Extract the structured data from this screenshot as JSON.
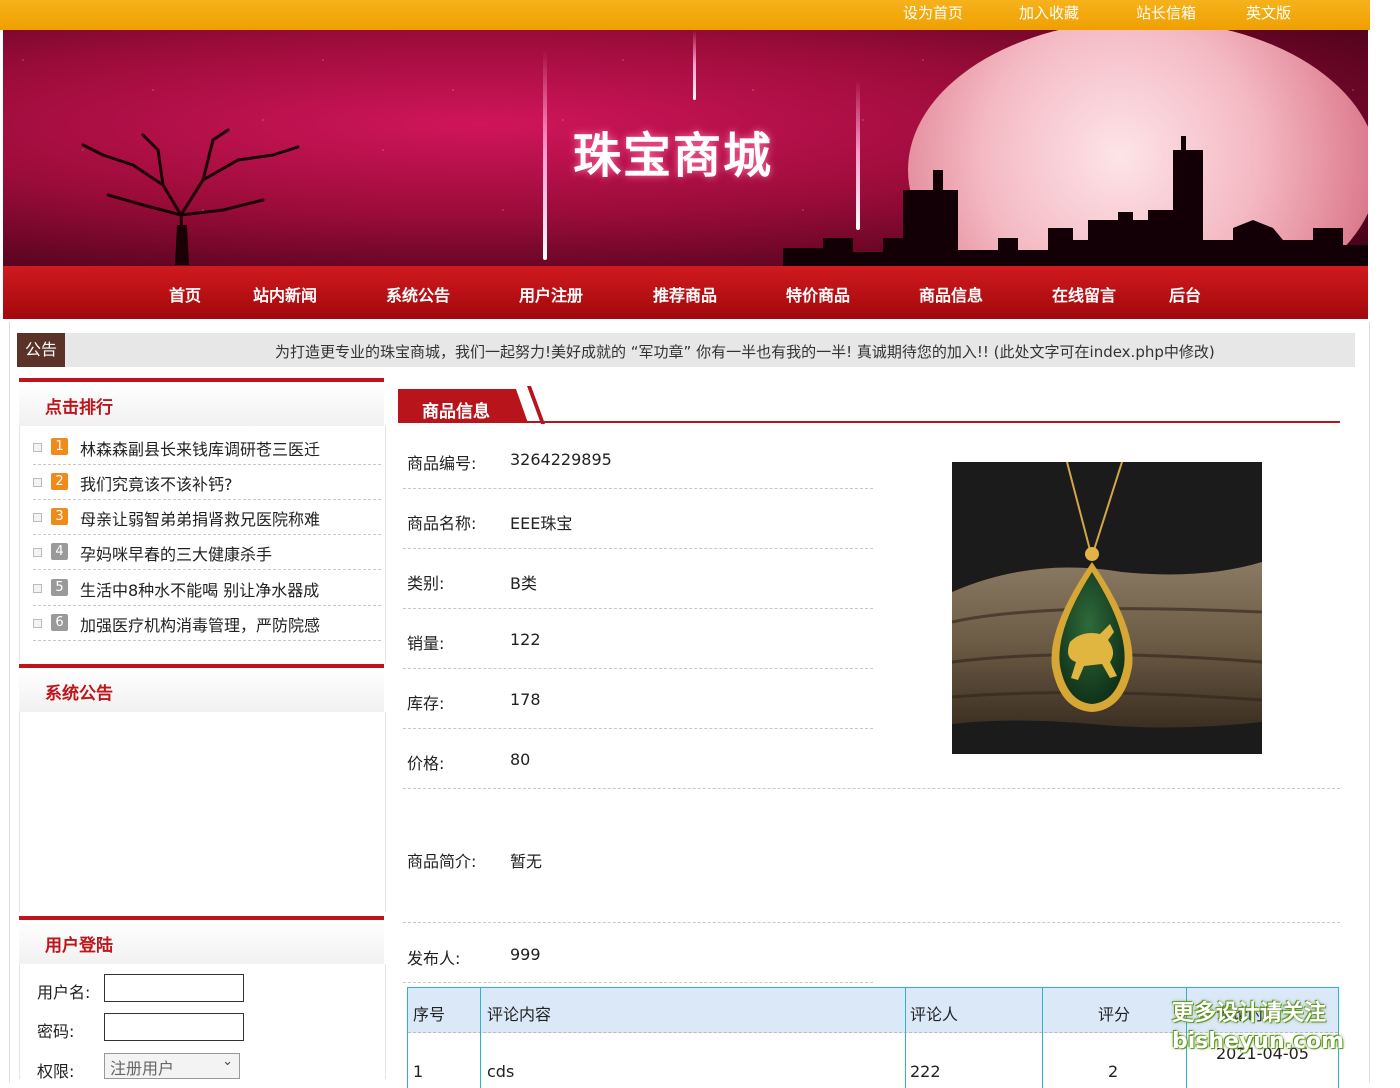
{
  "colors": {
    "top_bar": "#f6b21c",
    "nav_red": "#c0141b",
    "accent_red": "#b8141c",
    "notice_tag": "#5b3227",
    "table_border": "#29b4c8"
  },
  "top_links": [
    "设为首页",
    "加入收藏",
    "站长信箱",
    "英文版"
  ],
  "site_title": "珠宝商城",
  "nav": [
    "首页",
    "站内新闻",
    "系统公告",
    "用户注册",
    "推荐商品",
    "特价商品",
    "商品信息",
    "在线留言",
    "后台"
  ],
  "notice": {
    "tag": "公告",
    "text": "为打造更专业的珠宝商城，我们一起努力!美好成就的 “军功章” 你有一半也有我的一半! 真诚期待您的加入!! (此处文字可在index.php中修改)"
  },
  "ranking": {
    "title": "点击排行",
    "items": [
      {
        "num": "1",
        "label": "林森森副县长来钱库调研苍三医迁"
      },
      {
        "num": "2",
        "label": "我们究竟该不该补钙?"
      },
      {
        "num": "3",
        "label": "母亲让弱智弟弟捐肾救兄医院称难"
      },
      {
        "num": "4",
        "label": "孕妈咪早春的三大健康杀手"
      },
      {
        "num": "5",
        "label": "生活中8种水不能喝 别让净水器成"
      },
      {
        "num": "6",
        "label": "加强医疗机构消毒管理，严防院感"
      }
    ]
  },
  "announcements": {
    "title": "系统公告"
  },
  "login": {
    "title": "用户登陆",
    "username_label": "用户名:",
    "password_label": "密码:",
    "role_label": "权限:",
    "role_value": "注册用户"
  },
  "product": {
    "section_title": "商品信息",
    "fields": {
      "id": {
        "label": "商品编号:",
        "value": "3264229895"
      },
      "name": {
        "label": "商品名称:",
        "value": "EEE珠宝"
      },
      "category": {
        "label": "类别:",
        "value": "B类"
      },
      "sales": {
        "label": "销量:",
        "value": "122"
      },
      "stock": {
        "label": "库存:",
        "value": "178"
      },
      "price": {
        "label": "价格:",
        "value": "80"
      },
      "intro": {
        "label": "商品简介:",
        "value": "暂无"
      },
      "publisher": {
        "label": "发布人:",
        "value": "999"
      }
    }
  },
  "comments": {
    "headers": [
      "序号",
      "评论内容",
      "评论人",
      "评分",
      "评论时间"
    ],
    "rows": [
      [
        "1",
        "cds",
        "222",
        "2",
        "2021-04-05"
      ]
    ]
  },
  "watermark": {
    "line1": "更多设计请关注",
    "line2": "bisheyun.com"
  }
}
